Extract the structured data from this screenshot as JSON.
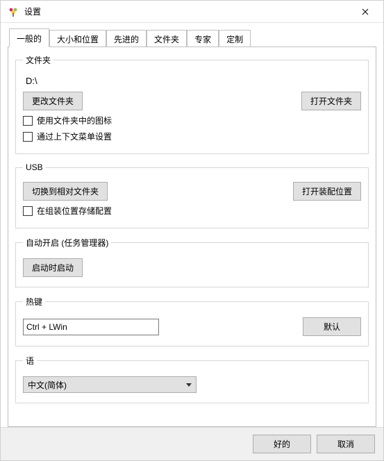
{
  "window": {
    "title": "设置"
  },
  "tabs": [
    {
      "label": "一般的"
    },
    {
      "label": "大小和位置"
    },
    {
      "label": "先进的"
    },
    {
      "label": "文件夹"
    },
    {
      "label": "专家"
    },
    {
      "label": "定制"
    }
  ],
  "folders": {
    "legend": "文件夹",
    "path": "D:\\",
    "change_btn": "更改文件夹",
    "open_btn": "打开文件夹",
    "cb_use_icons": "使用文件夹中的图标",
    "cb_context_menu": "通过上下文菜单设置"
  },
  "usb": {
    "legend": "USB",
    "switch_btn": "切换到相对文件夹",
    "open_assembly_btn": "打开装配位置",
    "cb_store_assembly": "在组装位置存储配置"
  },
  "autostart": {
    "legend": "自动开启 (任务管理器)",
    "btn": "启动时启动"
  },
  "hotkey": {
    "legend": "热键",
    "value": "Ctrl + LWin",
    "default_btn": "默认"
  },
  "lang": {
    "legend": "语",
    "value": "中文(简体)"
  },
  "footer": {
    "ok": "好的",
    "cancel": "取消"
  }
}
